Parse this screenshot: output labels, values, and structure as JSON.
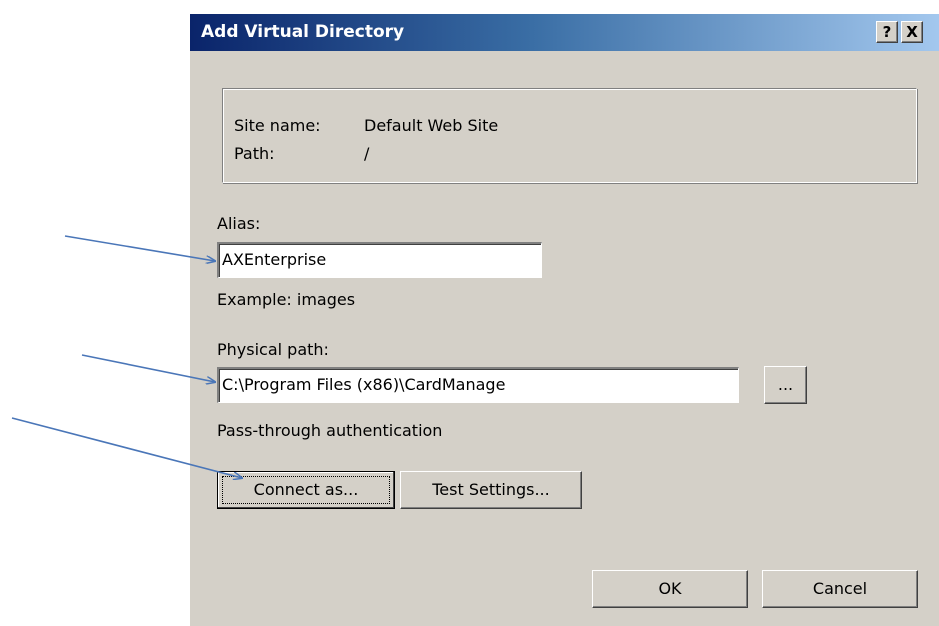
{
  "dialog": {
    "title": "Add Virtual Directory",
    "help_button": "?",
    "close_button": "X"
  },
  "info": {
    "site_name_label": "Site name:",
    "site_name_value": "Default Web Site",
    "path_label": "Path:",
    "path_value": "/"
  },
  "alias": {
    "label": "Alias:",
    "value": "AXEnterprise",
    "example": "Example: images"
  },
  "physical_path": {
    "label": "Physical path:",
    "value": "C:\\Program Files (x86)\\CardManage",
    "browse_button": "..."
  },
  "auth": {
    "label": "Pass-through authentication",
    "connect_as_button": "Connect as...",
    "test_settings_button": "Test Settings..."
  },
  "footer": {
    "ok_button": "OK",
    "cancel_button": "Cancel"
  },
  "colors": {
    "title_gradient_start": "#0a246a",
    "title_gradient_end": "#a6caf0",
    "dialog_face": "#d4d0c8",
    "annotation_arrow": "#4a76b8"
  },
  "icons": {
    "help": "question-mark-icon",
    "close": "close-x-icon"
  }
}
